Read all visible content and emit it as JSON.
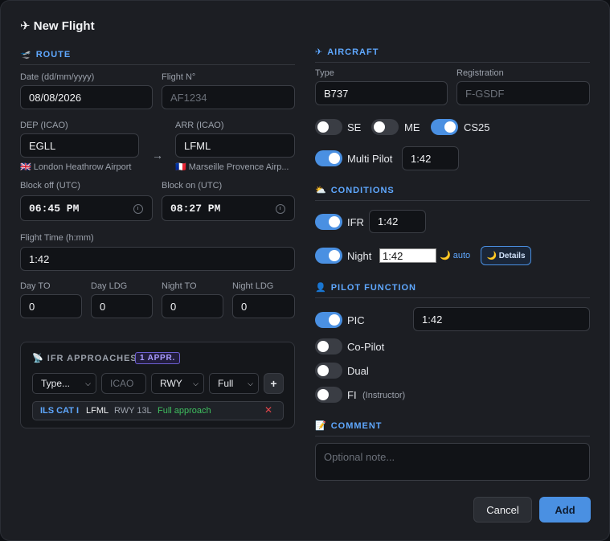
{
  "title": "✈ New Flight",
  "route": {
    "section": "ROUTE",
    "section_icon": "🛫",
    "date_label": "Date (dd/mm/yyyy)",
    "date_value": "08/08/2026",
    "flight_no_label": "Flight N°",
    "flight_no_placeholder": "AF1234",
    "dep_label": "DEP (ICAO)",
    "dep_value": "EGLL",
    "dep_flag": "🇬🇧",
    "dep_name": "London Heathrow Airport",
    "arr_label": "ARR (ICAO)",
    "arr_value": "LFML",
    "arr_flag": "🇫🇷",
    "arr_name": "Marseille Provence Airp...",
    "arrow": "→",
    "block_off_label": "Block off (UTC)",
    "block_off_value": "06:45  PM",
    "block_on_label": "Block on (UTC)",
    "block_on_value": "08:27  PM",
    "flight_time_label": "Flight Time (h:mm)",
    "flight_time_value": "1:42",
    "day_to_label": "Day TO",
    "day_to_value": "0",
    "day_ldg_label": "Day LDG",
    "day_ldg_value": "0",
    "night_to_label": "Night TO",
    "night_to_value": "0",
    "night_ldg_label": "Night LDG",
    "night_ldg_value": "0"
  },
  "approaches": {
    "icon": "📡",
    "title": "IFR APPROACHES",
    "badge": "1 APPR.",
    "type_select": "Type...",
    "icao_placeholder": "ICAO",
    "rwy_select": "RWY",
    "mode_select": "Full",
    "add_label": "+",
    "items": [
      {
        "type": "ILS CAT I",
        "icao": "LFML",
        "rwy": "RWY 13L",
        "mode": "Full approach",
        "remove": "✕"
      }
    ]
  },
  "aircraft": {
    "section": "AIRCRAFT",
    "section_icon": "✈",
    "type_label": "Type",
    "type_value": "B737",
    "reg_label": "Registration",
    "reg_placeholder": "F-GSDF",
    "se_label": "SE",
    "me_label": "ME",
    "cs25_label": "CS25",
    "multi_pilot_label": "Multi Pilot",
    "multi_pilot_time": "1:42",
    "toggles": {
      "se": false,
      "me": false,
      "cs25": true,
      "multi_pilot": true
    }
  },
  "conditions": {
    "section": "CONDITIONS",
    "section_icon": "⛅",
    "ifr_label": "IFR",
    "ifr_time": "1:42",
    "night_label": "Night",
    "night_time": "1:42",
    "night_auto": "🌙 auto",
    "details_label": "🌙 Details",
    "toggles": {
      "ifr": true,
      "night": true
    }
  },
  "pilot_function": {
    "section": "PILOT FUNCTION",
    "section_icon": "👤",
    "pic_label": "PIC",
    "pic_time": "1:42",
    "copilot_label": "Co-Pilot",
    "dual_label": "Dual",
    "fi_label": "FI",
    "fi_note": "(Instructor)",
    "toggles": {
      "pic": true,
      "copilot": false,
      "dual": false,
      "fi": false
    }
  },
  "comment": {
    "section": "COMMENT",
    "section_icon": "📝",
    "placeholder": "Optional note..."
  },
  "actions": {
    "cancel": "Cancel",
    "add": "Add"
  },
  "colors": {
    "accent": "#4a90e2",
    "section": "#5fa8ff",
    "background": "#1c1e23"
  }
}
